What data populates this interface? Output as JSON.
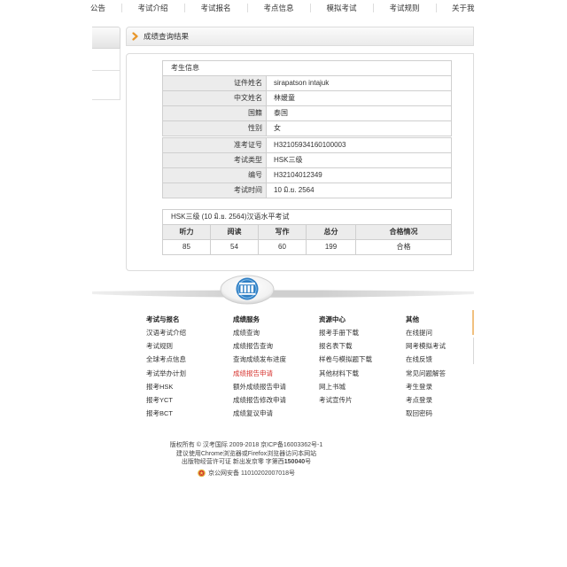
{
  "nav": {
    "items": [
      "公告",
      "考试介绍",
      "考试报名",
      "考点信息",
      "模拟考试",
      "考试规则",
      "关于我"
    ]
  },
  "panel": {
    "title": "成绩查询结果"
  },
  "candidate": {
    "section_title": "考生信息",
    "personal": [
      {
        "label": "证件姓名",
        "value": "sirapatson intajuk"
      },
      {
        "label": "中文姓名",
        "value": "林媛童"
      },
      {
        "label": "国籍",
        "value": "泰国"
      },
      {
        "label": "性别",
        "value": "女"
      }
    ],
    "exam": [
      {
        "label": "准考证号",
        "value": "H32105934160100003"
      },
      {
        "label": "考试类型",
        "value": "HSK三级"
      },
      {
        "label": "编号",
        "value": "H32104012349"
      },
      {
        "label": "考试时间",
        "value": "10 มิ.ย. 2564"
      }
    ]
  },
  "scores": {
    "title": "HSK三级 (10 มิ.ย. 2564)汉语水平考试",
    "headers": [
      "听力",
      "阅读",
      "写作",
      "总分",
      "合格情况"
    ],
    "values": [
      "85",
      "54",
      "60",
      "199",
      "合格"
    ]
  },
  "footer": {
    "columns": [
      {
        "heading": "考试与报名",
        "links": [
          "汉语考试介绍",
          "考试规则",
          "全球考点信息",
          "考试举办计划",
          "报考HSK",
          "报考YCT",
          "报考BCT"
        ]
      },
      {
        "heading": "成绩服务",
        "links": [
          "成绩查询",
          "成绩报告查询",
          "查询成绩发布进度",
          "成绩报告申请",
          "额外成绩报告申请",
          "成绩报告修改申请",
          "成绩复议申请"
        ]
      },
      {
        "heading": "资源中心",
        "links": [
          "报考手册下载",
          "报名表下载",
          "样卷与模拟题下载",
          "其他材料下载",
          "网上书城",
          "考试宣传片"
        ]
      },
      {
        "heading": "其他",
        "links": [
          "在线提问",
          "网考模拟考试",
          "在线反馈",
          "常见问题解答",
          "考生登录",
          "考点登录",
          "取回密码"
        ]
      }
    ],
    "copyright": "版权所有 © 汉考国际 2009-2018 京ICP备16003362号-1",
    "browser_note": "建议使用Chrome浏览器或Firefox浏览器访问本网站",
    "license": {
      "prefix": "出版物经营许可证 新出发京零 字第西",
      "number": "150040",
      "suffix": "号"
    },
    "police_record": "京公网安备 11010202007018号"
  },
  "icons": {
    "panel_header": "chevron-right-icon",
    "divider_logo": "hanban-logo-icon",
    "police_record": "police-badge-icon"
  },
  "colors": {
    "text": "#333333",
    "accent_orange": "#e8962a",
    "link_highlight": "#d6332e",
    "table_border": "#cfcfcf",
    "table_label_bg": "#ececec",
    "logo_blue": "#2f7fc4"
  }
}
